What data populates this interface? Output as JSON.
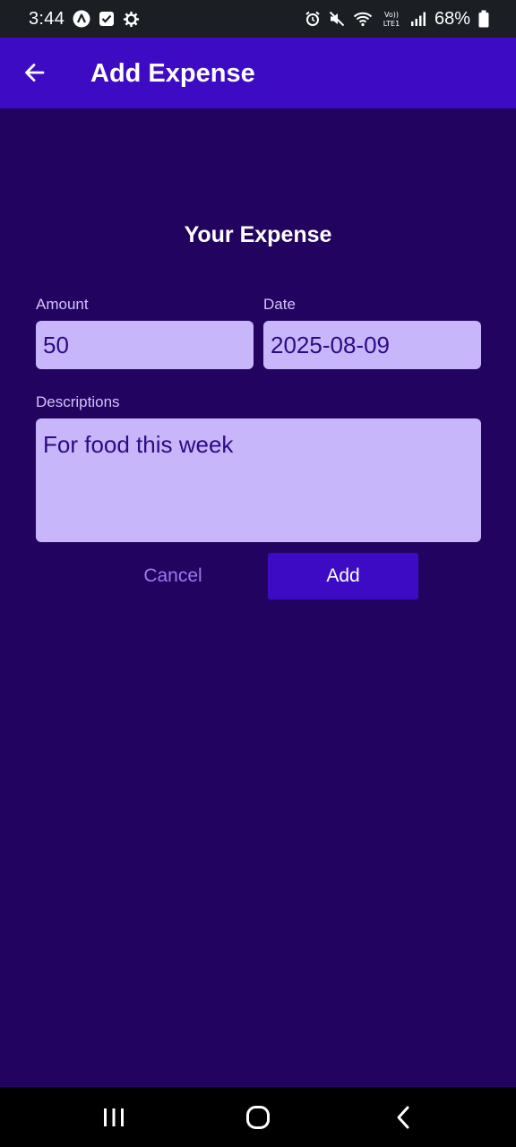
{
  "status_bar": {
    "time": "3:44",
    "battery_percent": "68%",
    "left_icons": [
      "app-a-icon",
      "check-square-icon",
      "gear-icon"
    ],
    "right_icons": [
      "alarm-icon",
      "mute-icon",
      "wifi-icon",
      "volte-icon",
      "signal-icon",
      "battery-icon"
    ],
    "volte_label": "Vo)) LTE1"
  },
  "app_bar": {
    "title": "Add Expense",
    "back_icon": "arrow-left-icon",
    "color": "#3d0bc4"
  },
  "form": {
    "title": "Your Expense",
    "amount": {
      "label": "Amount",
      "value": "50"
    },
    "date": {
      "label": "Date",
      "value": "2025-08-09"
    },
    "description": {
      "label": "Descriptions",
      "value": "For food this week"
    },
    "cancel_label": "Cancel",
    "add_label": "Add"
  },
  "nav_bar": {
    "icons": [
      "recent-apps-icon",
      "home-icon",
      "back-icon"
    ]
  },
  "colors": {
    "background": "#220460",
    "accent": "#3d0bc4",
    "field_fill": "#c8b6fa",
    "field_text": "#2c0a86"
  }
}
